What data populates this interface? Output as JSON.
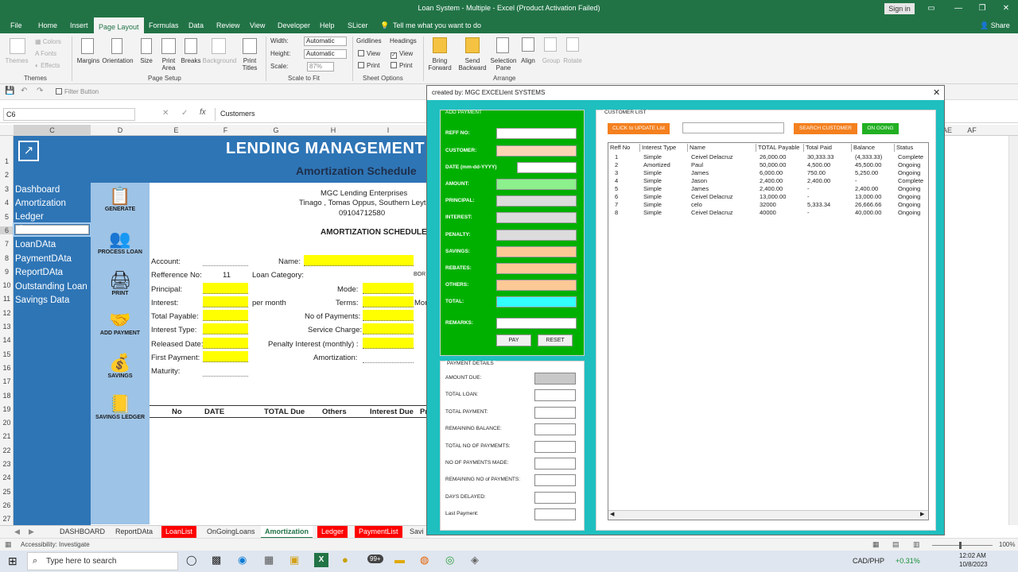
{
  "window": {
    "title": "Loan System - Multiple  -  Excel (Product Activation Failed)",
    "signin": "Sign in"
  },
  "menu": [
    "File",
    "Home",
    "Insert",
    "Page Layout",
    "Formulas",
    "Data",
    "Review",
    "View",
    "Developer",
    "Help",
    "SLicer"
  ],
  "menu_active": "Page Layout",
  "tell_me": "Tell me what you want to do",
  "share": "Share",
  "ribbon": {
    "themes": {
      "label": "Themes",
      "colors": "Colors",
      "fonts": "Fonts",
      "effects": "Effects"
    },
    "margins": "Margins",
    "orientation": "Orientation",
    "size": "Size",
    "print_area": "Print\nArea",
    "breaks": "Breaks",
    "background": "Background",
    "print_titles": "Print\nTitles",
    "width_label": "Width:",
    "width_value": "Automatic",
    "height_label": "Height:",
    "height_value": "Automatic",
    "scale_label": "Scale:",
    "scale_value": "87%",
    "gridlines": "Gridlines",
    "headings": "Headings",
    "view": "View",
    "print": "Print",
    "bring_forward": "Bring\nForward",
    "send_backward": "Send\nBackward",
    "selection_pane": "Selection\nPane",
    "align": "Align",
    "group": "Group",
    "rotate": "Rotate",
    "groups": {
      "themes": "Themes",
      "page_setup": "Page Setup",
      "scale_to_fit": "Scale to Fit",
      "sheet_options": "Sheet Options",
      "arrange": "Arrange"
    }
  },
  "qat": {
    "filter_button": "Filter Button"
  },
  "formula_bar": {
    "name_box": "C6",
    "content": "Customers"
  },
  "columns": [
    "C",
    "D",
    "E",
    "F",
    "G",
    "H",
    "I",
    "AE",
    "AF"
  ],
  "rows": [
    "1",
    "2",
    "3",
    "4",
    "5",
    "6",
    "7",
    "8",
    "9",
    "10",
    "11",
    "12",
    "13",
    "14",
    "15",
    "16",
    "17",
    "18",
    "19",
    "20",
    "21",
    "22",
    "23",
    "24",
    "25",
    "26",
    "27"
  ],
  "sidebar": [
    "Dashboard",
    "Amortization",
    "Ledger",
    "Customers",
    "LoanDAta",
    "PaymentDAta",
    "ReportDAta",
    "Outstanding Loan",
    "Savings Data"
  ],
  "sidebar_selected": "Customers",
  "tools": [
    "GENERATE",
    "PROCESS LOAN",
    "PRINT",
    "ADD PAYMENT",
    "SAVINGS",
    "SAVINGS LEDGER"
  ],
  "sheet": {
    "banner_title": "LENDING MANAGEMENT",
    "banner_sub": "Amortization Schedule",
    "company": "MGC Lending Enterprises",
    "address": "Tinago , Tomas Oppus, Southern Leyte",
    "phone": "09104712580",
    "schedule_title": "AMORTIZATION SCHEDULE",
    "account": "Account:",
    "name": "Name:",
    "reference": "Refference No:",
    "reference_value": "11",
    "loan_category": "Loan Category:",
    "bor": "BOR",
    "principal": "Principal:",
    "mode": "Mode:",
    "interest": "Interest:",
    "per_month": "per month",
    "terms": "Terms:",
    "mor": "Mor",
    "total_payable": "Total Payable:",
    "no_payments": "No of Payments:",
    "interest_type": "Interest Type:",
    "service_charge": "Service Charge:",
    "released_date": "Released Date:",
    "penalty": "Penalty Interest (monthly) :",
    "first_payment": "First Payment:",
    "amortization": "Amortization:",
    "maturity": "Maturity:",
    "table_headers": [
      "No",
      "DATE",
      "TOTAL Due",
      "Others",
      "Interest Due",
      "Pr"
    ]
  },
  "sheet_tabs": [
    {
      "label": "DASHBOARD",
      "style": "normal"
    },
    {
      "label": "ReportDAta",
      "style": "normal"
    },
    {
      "label": "LoanList",
      "style": "red"
    },
    {
      "label": "OnGoingLoans",
      "style": "normal"
    },
    {
      "label": "Amortization",
      "style": "active"
    },
    {
      "label": "Ledger",
      "style": "red"
    },
    {
      "label": "PaymentList",
      "style": "red"
    },
    {
      "label": "Savi",
      "style": "normal"
    }
  ],
  "status": {
    "accessibility": "Accessibility: Investigate",
    "zoom": "100%"
  },
  "taskbar": {
    "search": "Type here to search",
    "badge": "99+",
    "currency": "CAD/PHP",
    "change": "+0.31%",
    "time": "12:02 AM",
    "date": "10/8/2023"
  },
  "dialog": {
    "title": "created by: MGC EXCELlent SYSTEMS",
    "add_payment": {
      "label": "ADD PAYMENT",
      "fields": [
        {
          "label": "REFF NO:",
          "color": "#ffffff"
        },
        {
          "label": "CUSTOMER:",
          "color": "#fcd5b4"
        },
        {
          "label": "DATE (mm-dd-YYYY)",
          "color": "#ffffff"
        },
        {
          "label": "AMOUNT:",
          "color": "#8cf08c"
        },
        {
          "label": "PRINCIPAL:",
          "color": "#dcdcdc"
        },
        {
          "label": "INTEREST:",
          "color": "#dcdcdc"
        },
        {
          "label": "PENALTY:",
          "color": "#dcdcdc"
        },
        {
          "label": "SAVINGS:",
          "color": "#fcc896"
        },
        {
          "label": "REBATES:",
          "color": "#fcc896"
        },
        {
          "label": "OTHERS:",
          "color": "#fcc896"
        },
        {
          "label": "TOTAL:",
          "color": "#33ffff"
        },
        {
          "label": "REMARKS:",
          "color": "#ffffff"
        }
      ],
      "pay": "PAY",
      "reset": "RESET"
    },
    "payment_details": {
      "label": "PAYMENT DETAILS",
      "fields": [
        "AMOUNT DUE:",
        "TOTAL LOAN:",
        "TOTAL PAYMENT:",
        "REMAINING BALANCE:",
        "TOTAL NO OF PAYMEMTS:",
        "NO OF PAYMENTS MADE:",
        "REMAINING NO of PAYMENTS:",
        "DAYS DELAYED:",
        "Last Payment:"
      ]
    },
    "customer_list": {
      "label": "CUSTOMER LIST",
      "update_btn": "CLICK to UPDATE List",
      "search_btn": "SEARCH CUSTOMER",
      "ongoing_btn": "ON GOING",
      "colors": {
        "orange": "#f4801f",
        "green": "#22b022"
      },
      "headers": [
        "Reff No",
        "Interest Type",
        "Name",
        "TOTAL Payable",
        "Total Paid",
        "Balance",
        "Status"
      ],
      "rows": [
        [
          "1",
          "Simple",
          "Ceivel Delacruz",
          "26,000.00",
          "30,333.33",
          "(4,333.33)",
          "Complete"
        ],
        [
          "2",
          "Amortized",
          "Paul",
          "50,000.00",
          "4,500.00",
          "45,500.00",
          "Ongoing"
        ],
        [
          "3",
          "Simple",
          "James",
          "6,000.00",
          "750.00",
          "5,250.00",
          "Ongoing"
        ],
        [
          "4",
          "Simple",
          "Jason",
          "2,400.00",
          "2,400.00",
          "-",
          "Complete"
        ],
        [
          "5",
          "Simple",
          "James",
          "2,400.00",
          "-",
          "2,400.00",
          "Ongoing"
        ],
        [
          "6",
          "Simple",
          "Ceivel Delacruz",
          "13,000.00",
          "-",
          "13,000.00",
          "Ongoing"
        ],
        [
          "7",
          "Simple",
          "celo",
          "32000",
          "5,333.34",
          "26,666.66",
          "Ongoing"
        ],
        [
          "8",
          "Simple",
          "Ceivel Delacruz",
          "40000",
          "-",
          "40,000.00",
          "Ongoing"
        ]
      ]
    }
  }
}
